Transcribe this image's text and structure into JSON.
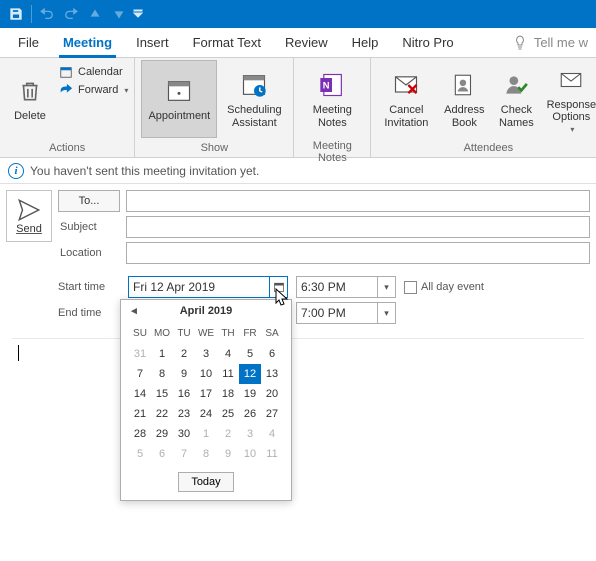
{
  "quick_access": {
    "save": "save-icon",
    "undo": "undo-icon",
    "redo": "redo-icon"
  },
  "menu": {
    "items": [
      "File",
      "Meeting",
      "Insert",
      "Format Text",
      "Review",
      "Help",
      "Nitro Pro"
    ],
    "active_index": 1,
    "tell_me": "Tell me w"
  },
  "ribbon": {
    "groups": [
      {
        "label": "Actions",
        "delete": "Delete",
        "calendar": "Calendar",
        "forward": "Forward"
      },
      {
        "label": "Show",
        "appointment": "Appointment",
        "scheduling": "Scheduling\nAssistant"
      },
      {
        "label": "Meeting Notes",
        "notes": "Meeting\nNotes"
      },
      {
        "label": "Attendees",
        "cancel": "Cancel\nInvitation",
        "address": "Address\nBook",
        "check": "Check\nNames",
        "response": "Response\nOptions"
      }
    ]
  },
  "infobar": {
    "text": "You haven't sent this meeting invitation yet."
  },
  "form": {
    "send": "Send",
    "to": "To...",
    "subject": "Subject",
    "location": "Location",
    "start_time_label": "Start time",
    "end_time_label": "End time",
    "start_date": "Fri 12 Apr 2019",
    "start_time": "6:30 PM",
    "end_time": "7:00 PM",
    "all_day": "All day event"
  },
  "datepicker": {
    "title": "April 2019",
    "dow": [
      "SU",
      "MO",
      "TU",
      "WE",
      "TH",
      "FR",
      "SA"
    ],
    "weeks": [
      [
        {
          "d": 31,
          "o": true
        },
        {
          "d": 1
        },
        {
          "d": 2
        },
        {
          "d": 3
        },
        {
          "d": 4
        },
        {
          "d": 5
        },
        {
          "d": 6
        }
      ],
      [
        {
          "d": 7
        },
        {
          "d": 8
        },
        {
          "d": 9
        },
        {
          "d": 10
        },
        {
          "d": 11
        },
        {
          "d": 12,
          "sel": true
        },
        {
          "d": 13
        }
      ],
      [
        {
          "d": 14
        },
        {
          "d": 15
        },
        {
          "d": 16
        },
        {
          "d": 17
        },
        {
          "d": 18
        },
        {
          "d": 19
        },
        {
          "d": 20
        }
      ],
      [
        {
          "d": 21
        },
        {
          "d": 22
        },
        {
          "d": 23
        },
        {
          "d": 24
        },
        {
          "d": 25
        },
        {
          "d": 26
        },
        {
          "d": 27
        }
      ],
      [
        {
          "d": 28
        },
        {
          "d": 29
        },
        {
          "d": 30
        },
        {
          "d": 1,
          "o": true
        },
        {
          "d": 2,
          "o": true
        },
        {
          "d": 3,
          "o": true
        },
        {
          "d": 4,
          "o": true
        }
      ],
      [
        {
          "d": 5,
          "o": true
        },
        {
          "d": 6,
          "o": true
        },
        {
          "d": 7,
          "o": true
        },
        {
          "d": 8,
          "o": true
        },
        {
          "d": 9,
          "o": true
        },
        {
          "d": 10,
          "o": true
        },
        {
          "d": 11,
          "o": true
        }
      ]
    ],
    "today": "Today"
  }
}
